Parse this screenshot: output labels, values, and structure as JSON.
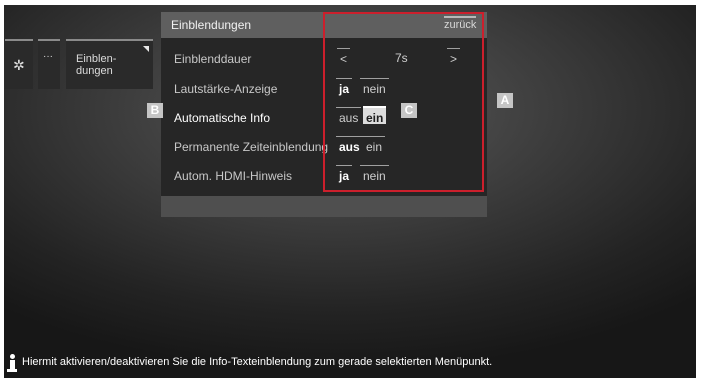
{
  "sidebar": {
    "gear_icon": "gear-icon",
    "dots_label": "···",
    "einbl_line1": "Einblen-",
    "einbl_line2": "dungen"
  },
  "panel": {
    "title": "Einblendungen",
    "back_label": "zurück"
  },
  "rows": [
    {
      "label": "Einblenddauer",
      "value": "7s",
      "left": "<",
      "right": ">"
    },
    {
      "label": "Lautstärke-Anzeige",
      "options": [
        "ja",
        "nein"
      ],
      "selected": "ja"
    },
    {
      "label": "Automatische Info",
      "options": [
        "aus",
        "ein"
      ],
      "selected": "ein",
      "focused": true
    },
    {
      "label": "Permanente Zeiteinblendung",
      "options": [
        "aus",
        "ein"
      ],
      "selected": "aus"
    },
    {
      "label": "Autom. HDMI-Hinweis",
      "options": [
        "ja",
        "nein"
      ],
      "selected": "ja"
    }
  ],
  "annotations": {
    "a": "A",
    "b": "B",
    "c": "C",
    "box_color": "#cc1f2c"
  },
  "info": {
    "icon": "info-icon",
    "text": "Hiermit aktivieren/deaktivieren Sie die Info-Texteinblendung zum gerade selektierten Menüpunkt."
  }
}
